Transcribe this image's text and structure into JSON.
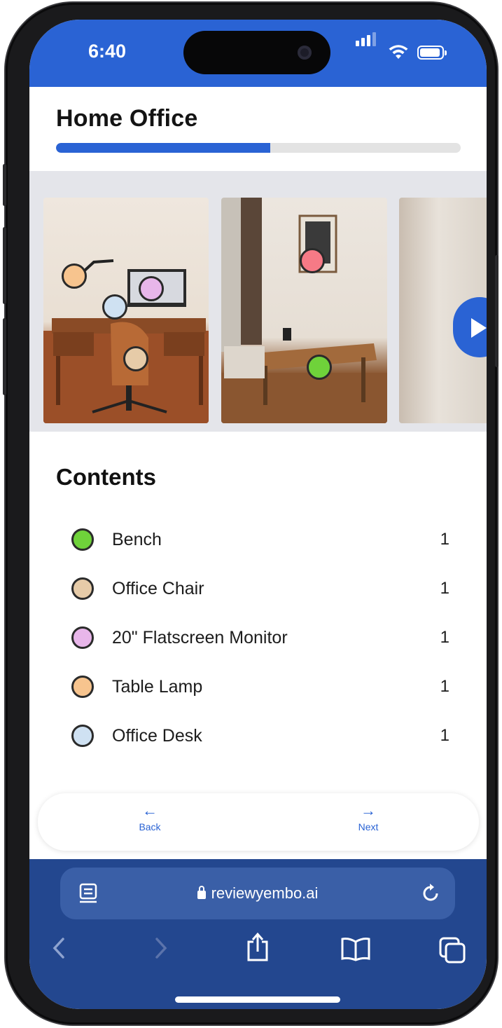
{
  "status_bar": {
    "time": "6:40"
  },
  "page": {
    "title": "Home Office",
    "progress": 0.53
  },
  "gallery": {
    "photos": [
      {
        "markers": [
          "#f7c48e",
          "#e8b6ea",
          "#cfe1f2",
          "#e6cba8"
        ]
      },
      {
        "markers": [
          "#f67a86",
          "#6fd23a"
        ]
      },
      {
        "markers": []
      }
    ]
  },
  "contents": {
    "title": "Contents",
    "items": [
      {
        "name": "Bench",
        "qty": "1",
        "color": "#6fd23a"
      },
      {
        "name": "Office Chair",
        "qty": "1",
        "color": "#e6cba8"
      },
      {
        "name": "20\" Flatscreen Monitor",
        "qty": "1",
        "color": "#e8b6ea"
      },
      {
        "name": "Table Lamp",
        "qty": "1",
        "color": "#f7c48e"
      },
      {
        "name": "Office Desk",
        "qty": "1",
        "color": "#cfe1f2"
      }
    ]
  },
  "nav": {
    "back_label": "Back",
    "next_label": "Next",
    "back_arrow": "←",
    "next_arrow": "→"
  },
  "browser": {
    "url": "reviewyembo.ai"
  },
  "colors": {
    "accent": "#2a63d4",
    "browser_bar": "#23478f"
  }
}
